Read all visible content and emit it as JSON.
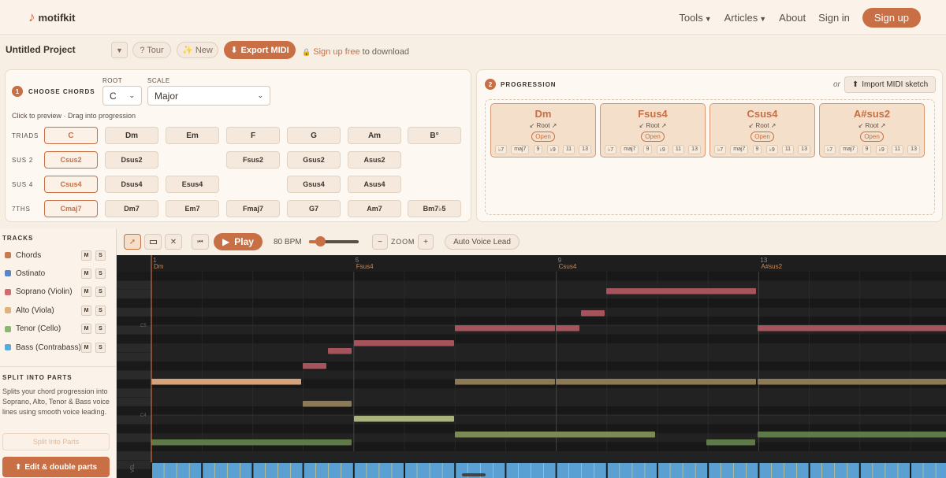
{
  "nav": {
    "logo": "motifkit",
    "links": [
      "Tools",
      "Articles",
      "About",
      "Sign in"
    ],
    "signup": "Sign up"
  },
  "project": {
    "title": "Untitled Project",
    "tour": "? Tour",
    "new": "✨ New",
    "export": "Export MIDI",
    "signup_link": "Sign up free",
    "download_note": " to download"
  },
  "chooser": {
    "step": "1",
    "title": "CHOOSE CHORDS",
    "root_label": "ROOT",
    "root_value": "C",
    "scale_label": "SCALE",
    "scale_value": "Major",
    "hint": "Click to preview · Drag into progression",
    "rows": [
      {
        "label": "TRIADS",
        "chords": [
          "C",
          "Dm",
          "Em",
          "F",
          "G",
          "Am",
          "B°"
        ]
      },
      {
        "label": "SUS 2",
        "chords": [
          "Csus2",
          "Dsus2",
          "",
          "Fsus2",
          "Gsus2",
          "Asus2",
          ""
        ]
      },
      {
        "label": "SUS 4",
        "chords": [
          "Csus4",
          "Dsus4",
          "Esus4",
          "",
          "Gsus4",
          "Asus4",
          ""
        ]
      },
      {
        "label": "7THS",
        "chords": [
          "Cmaj7",
          "Dm7",
          "Em7",
          "Fmaj7",
          "G7",
          "Am7",
          "Bm7♭5"
        ]
      }
    ]
  },
  "progression": {
    "step": "2",
    "title": "PROGRESSION",
    "or": "or",
    "import": "Import MIDI sketch",
    "cards": [
      {
        "name": "Dm",
        "voicing": "Root",
        "mode": "Open"
      },
      {
        "name": "Fsus4",
        "voicing": "Root",
        "mode": "Open"
      },
      {
        "name": "Csus4",
        "voicing": "Root",
        "mode": "Open"
      },
      {
        "name": "A#sus2",
        "voicing": "Root",
        "mode": "Open"
      }
    ],
    "extensions": [
      "♭7",
      "maj7",
      "9",
      "♭9",
      "11",
      "13"
    ]
  },
  "toolbar": {
    "play": "Play",
    "bpm": "80 BPM",
    "tempo_value": 80,
    "zoom_label": "ZOOM",
    "minus": "−",
    "plus": "+",
    "auto_voice": "Auto Voice Lead"
  },
  "tracks": {
    "header": "TRACKS",
    "mute": "M",
    "solo": "S",
    "items": [
      {
        "name": "Chords",
        "color": "#c87a50"
      },
      {
        "name": "Ostinato",
        "color": "#5b85c9"
      },
      {
        "name": "Soprano (Violin)",
        "color": "#d26a72"
      },
      {
        "name": "Alto (Viola)",
        "color": "#e0b27a"
      },
      {
        "name": "Tenor (Cello)",
        "color": "#8ab871"
      },
      {
        "name": "Bass (Contrabass)",
        "color": "#5aa9dd"
      }
    ]
  },
  "split": {
    "title": "SPLIT INTO PARTS",
    "desc": "Splits your chord progression into Soprano, Alto, Tenor & Bass voice lines using smooth voice leading.",
    "button": "Split Into Parts",
    "edit": "Edit & double parts"
  },
  "roll": {
    "markers": [
      {
        "bar": "1",
        "chord": "Dm"
      },
      {
        "bar": "5",
        "chord": "Fsus4"
      },
      {
        "bar": "9",
        "chord": "Csus4"
      },
      {
        "bar": "13",
        "chord": "A#sus2"
      }
    ],
    "octave_labels": [
      "C5",
      "C4"
    ],
    "vel_label": "VEL"
  }
}
